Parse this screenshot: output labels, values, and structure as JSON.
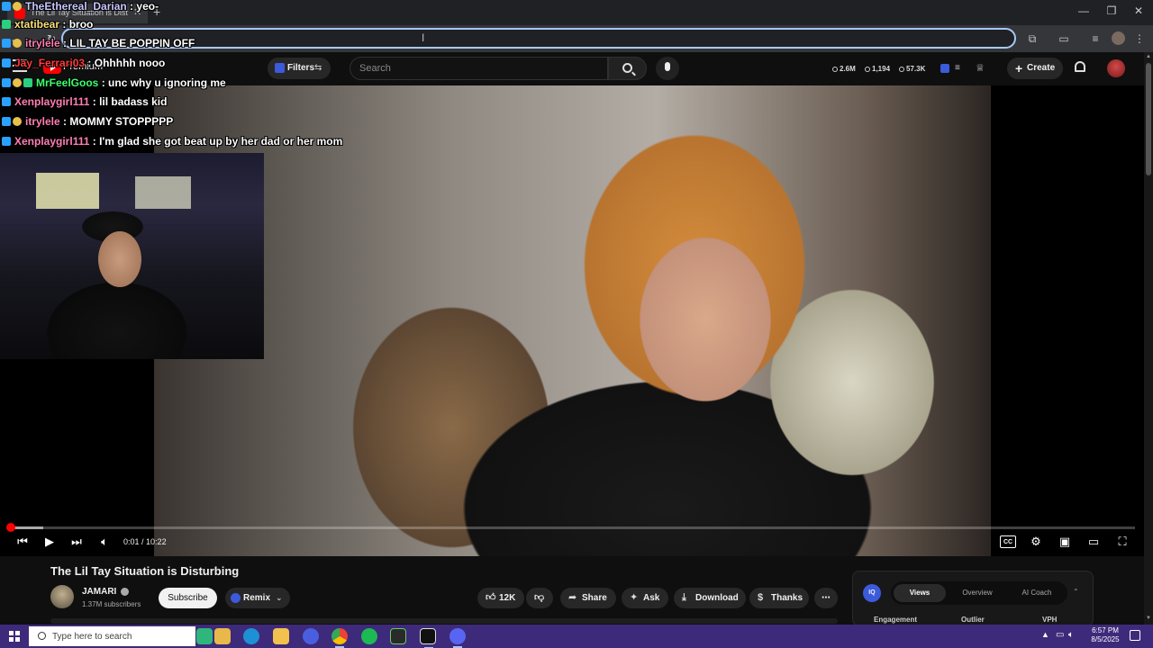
{
  "browser": {
    "tab_title": "The Lil Tay Situation is Disturbing - YouTube",
    "tab_close_glyph": "✕",
    "new_tab_glyph": "+",
    "window_buttons": {
      "minimize": "—",
      "restore": "❐",
      "close": "✕"
    },
    "cursor_glyph": "I"
  },
  "chat": {
    "messages": [
      {
        "user": "TheEthereal_Darian",
        "message": "yeo-",
        "user_color": "#c7c7ff"
      },
      {
        "user": "xtatibear",
        "message": "broo",
        "user_color": "#f7e07a"
      },
      {
        "user": "itrylele",
        "message": "LIL TAY BE POPPIN OFF",
        "user_color": "#ff7fb0"
      },
      {
        "user": "Jay_Ferrari03",
        "message": "Ohhhhh nooo",
        "user_color": "#ff3b3b"
      },
      {
        "user": "MrFeelGoos",
        "message": "unc why u ignoring me",
        "user_color": "#3cff6e"
      },
      {
        "user": "Xenplaygirl111",
        "message": "lil badass kid",
        "user_color": "#ff7fb0"
      },
      {
        "user": "itrylele",
        "message": "MOMMY STOPPPPP",
        "user_color": "#ff7fb0"
      },
      {
        "user": "Xenplaygirl111",
        "message": "I'm glad she got beat up by her dad or her mom",
        "user_color": "#ff7fb0"
      }
    ]
  },
  "youtube_header": {
    "premium_label": "Premium",
    "filters_label": "Filters",
    "search_placeholder": "Search",
    "stats": {
      "views": "2.6M",
      "likes": "1,194",
      "subs": "57.3K"
    },
    "create_label": "Create"
  },
  "player": {
    "current_time": "0:01",
    "duration": "10:22",
    "progress_fraction": 0.0016,
    "buffered_fraction": 0.03
  },
  "video": {
    "title": "The Lil Tay Situation is Disturbing",
    "channel_name": "JAMARI",
    "subscribers": "1.37M subscribers",
    "subscribe_label": "Subscribe",
    "remix_label": "Remix",
    "like_count": "12K",
    "share_label": "Share",
    "ask_label": "Ask",
    "download_label": "Download",
    "thanks_label": "Thanks",
    "more_glyph": "⋯"
  },
  "iq_panel": {
    "logo_text": "IQ",
    "tabs": [
      "Views",
      "Overview",
      "AI Coach"
    ],
    "active_tab": "Views",
    "columns": [
      "Engagement",
      "Outlier",
      "VPH"
    ]
  },
  "taskbar": {
    "search_placeholder": "Type here to search",
    "time": "6:57 PM",
    "date": "8/5/2025"
  },
  "colors": {
    "youtube_red": "#ff0000",
    "taskbar": "#3e2a7a",
    "omnibox_focus": "#a8c7fa"
  }
}
